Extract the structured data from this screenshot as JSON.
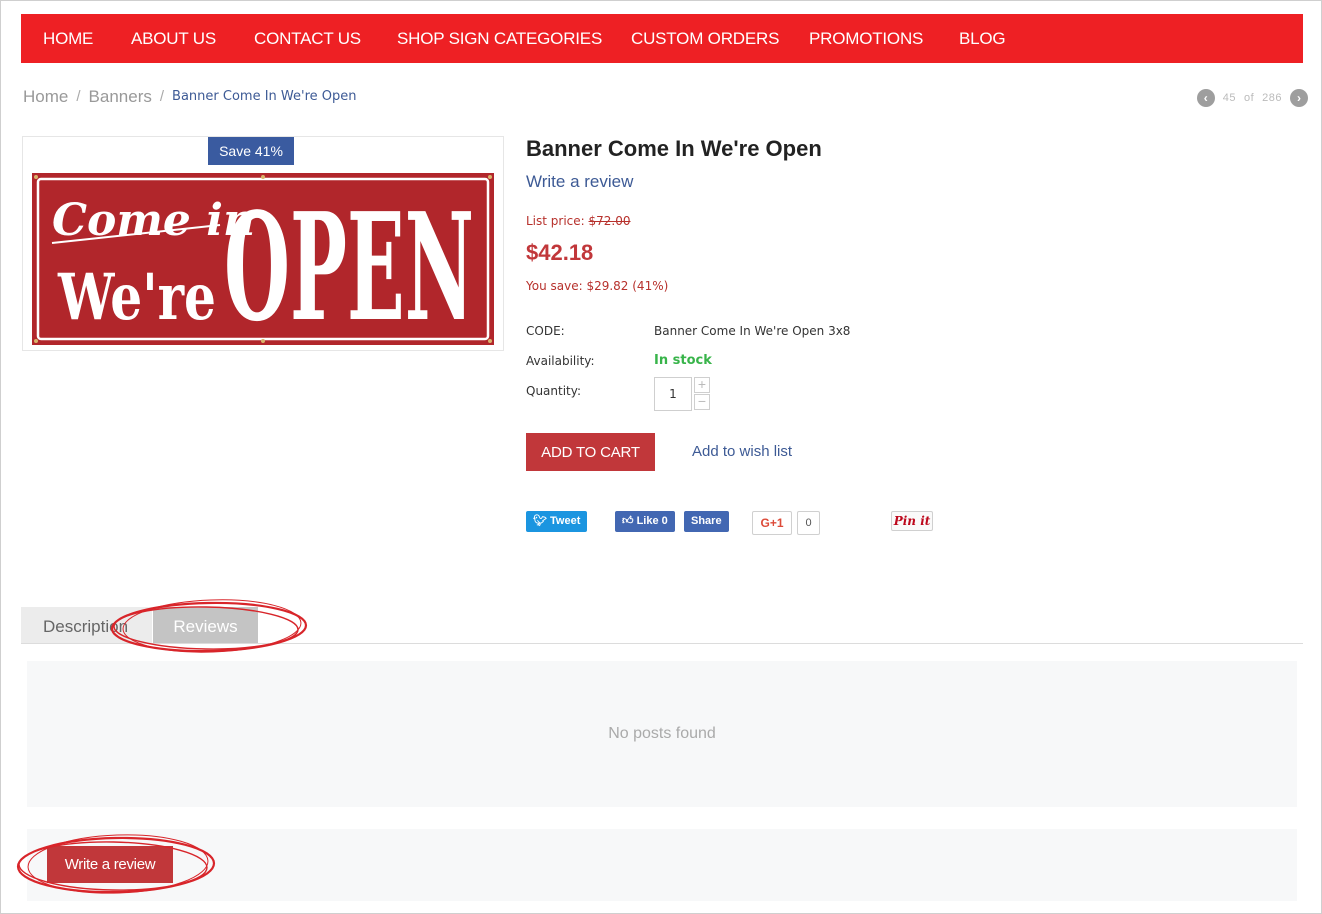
{
  "nav": {
    "items": [
      "HOME",
      "ABOUT US",
      "CONTACT US",
      "SHOP SIGN CATEGORIES",
      "CUSTOM ORDERS",
      "PROMOTIONS",
      "BLOG"
    ]
  },
  "breadcrumb": {
    "home": "Home",
    "category": "Banners",
    "current": "Banner Come In We're Open"
  },
  "pager": {
    "current": "45",
    "of": "of",
    "total": "286"
  },
  "product": {
    "save_badge": "Save 41%",
    "banner_text": {
      "line1": "Come in",
      "line2": "We're",
      "line3": "OPEN"
    },
    "title": "Banner Come In We're Open",
    "write_review": "Write a review",
    "list_price_label": "List price:",
    "list_price": "$72.00",
    "price": "$42.18",
    "you_save": "You save: $29.82 (41%)",
    "code_label": "CODE:",
    "code_value": "Banner Come In We're Open 3x8",
    "availability_label": "Availability:",
    "availability_value": "In stock",
    "quantity_label": "Quantity:",
    "quantity_value": "1",
    "add_to_cart": "ADD TO CART",
    "add_to_wish": "Add to wish list"
  },
  "social": {
    "tweet": "Tweet",
    "like": "Like 0",
    "share": "Share",
    "gplus": "G+1",
    "gplus_count": "0",
    "pinit": "Pin it"
  },
  "tabs": {
    "description": "Description",
    "reviews": "Reviews"
  },
  "reviews": {
    "empty": "No posts found",
    "write_button": "Write a review"
  },
  "colors": {
    "nav_red": "#ee2024",
    "button_red": "#c1373a",
    "link_blue": "#3d5a95",
    "badge_blue": "#3a5ba0",
    "stock_green": "#38b44a",
    "banner_red": "#b1262b"
  }
}
